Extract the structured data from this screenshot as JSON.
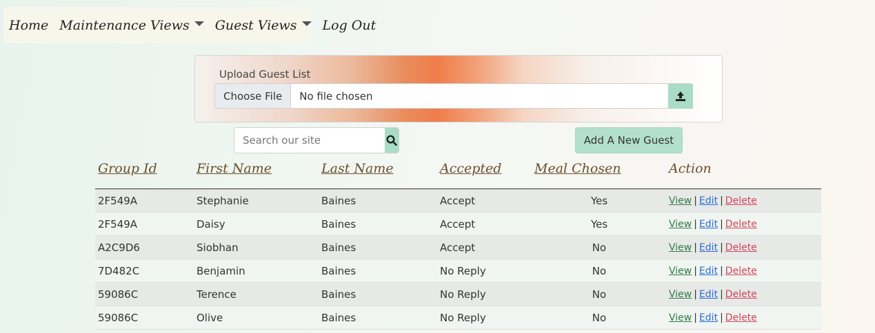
{
  "nav": {
    "home": "Home",
    "maintenance": "Maintenance Views",
    "guest": "Guest Views",
    "logout": "Log Out"
  },
  "upload": {
    "label": "Upload Guest List",
    "choose_file": "Choose File",
    "file_name": "No file chosen"
  },
  "search": {
    "placeholder": "Search our site"
  },
  "add_guest_label": "Add A New Guest",
  "table": {
    "headers": [
      "Group Id",
      "First Name",
      "Last Name",
      "Accepted",
      "Meal Chosen",
      "Action"
    ],
    "actions": {
      "view": "View",
      "edit": "Edit",
      "delete": "Delete",
      "separator": "|"
    },
    "rows": [
      {
        "group_id": "2F549A",
        "first": "Stephanie",
        "last": "Baines",
        "accepted": "Accept",
        "meal": "Yes"
      },
      {
        "group_id": "2F549A",
        "first": "Daisy",
        "last": "Baines",
        "accepted": "Accept",
        "meal": "Yes"
      },
      {
        "group_id": "A2C9D6",
        "first": "Siobhan",
        "last": "Baines",
        "accepted": "Accept",
        "meal": "No"
      },
      {
        "group_id": "7D482C",
        "first": "Benjamin",
        "last": "Baines",
        "accepted": "No Reply",
        "meal": "No"
      },
      {
        "group_id": "59086C",
        "first": "Terence",
        "last": "Baines",
        "accepted": "No Reply",
        "meal": "No"
      },
      {
        "group_id": "59086C",
        "first": "Olive",
        "last": "Baines",
        "accepted": "No Reply",
        "meal": "No"
      }
    ]
  },
  "colors": {
    "accent_button": "#a9dcc9",
    "heading": "#6b4e2b",
    "view_link": "#2f7a44",
    "edit_link": "#2a6bd6",
    "delete_link": "#d0455a"
  },
  "icons": {
    "upload": "upload-icon",
    "search": "search-icon",
    "dropdown": "caret-down-icon"
  }
}
